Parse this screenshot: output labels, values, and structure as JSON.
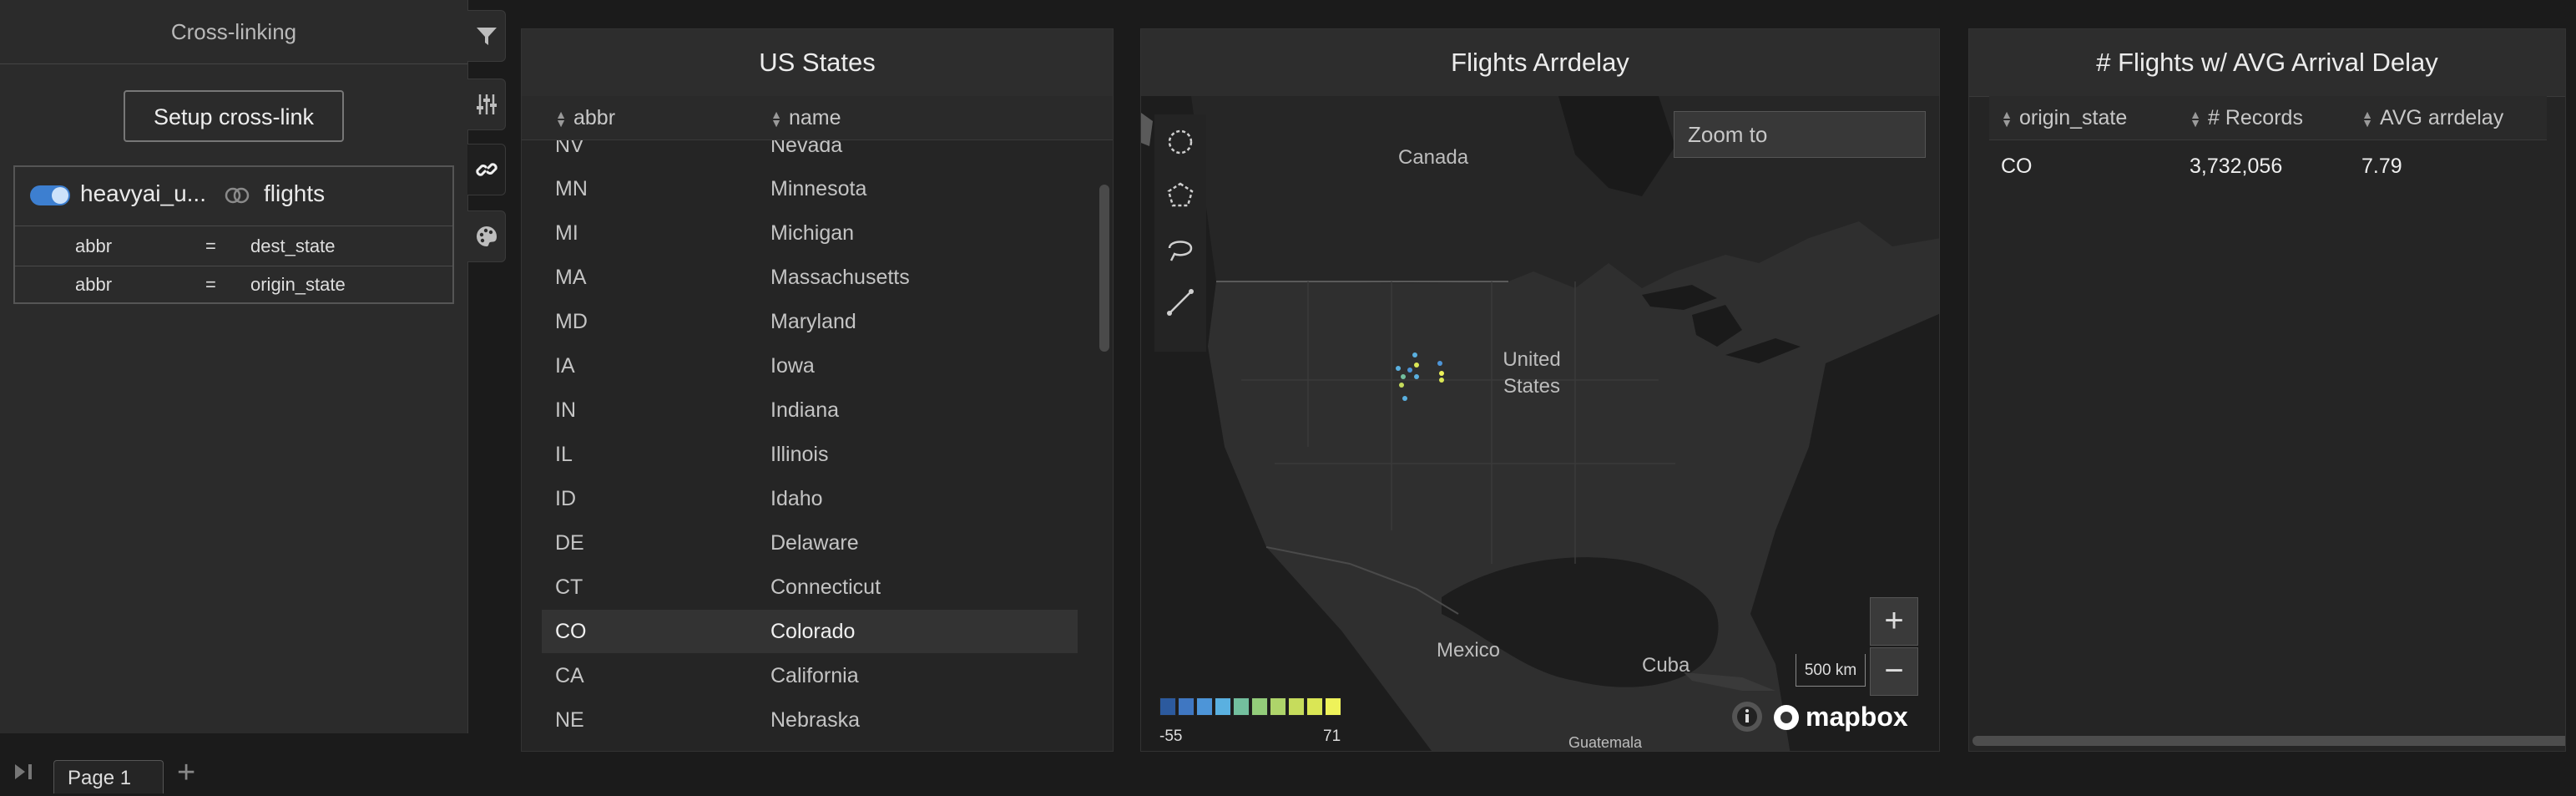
{
  "sidebar": {
    "title": "Cross-linking",
    "setup_button": "Setup cross-link",
    "link": {
      "source": "heavyai_u...",
      "target": "flights",
      "mappings": [
        {
          "left": "abbr",
          "op": "=",
          "right": "dest_state"
        },
        {
          "left": "abbr",
          "op": "=",
          "right": "origin_state"
        }
      ]
    }
  },
  "toolbar": {
    "icons": [
      "filter-icon",
      "sliders-icon",
      "link-icon",
      "palette-icon"
    ],
    "active": "link-icon"
  },
  "pages": {
    "tab_label": "Page 1",
    "add": "+"
  },
  "us_states": {
    "title": "US States",
    "columns": [
      "abbr",
      "name"
    ],
    "partial_row": {
      "abbr": "NV",
      "name": "Nevada"
    },
    "rows": [
      {
        "abbr": "MN",
        "name": "Minnesota"
      },
      {
        "abbr": "MI",
        "name": "Michigan"
      },
      {
        "abbr": "MA",
        "name": "Massachusetts"
      },
      {
        "abbr": "MD",
        "name": "Maryland"
      },
      {
        "abbr": "IA",
        "name": "Iowa"
      },
      {
        "abbr": "IN",
        "name": "Indiana"
      },
      {
        "abbr": "IL",
        "name": "Illinois"
      },
      {
        "abbr": "ID",
        "name": "Idaho"
      },
      {
        "abbr": "DE",
        "name": "Delaware"
      },
      {
        "abbr": "CT",
        "name": "Connecticut"
      },
      {
        "abbr": "CO",
        "name": "Colorado"
      },
      {
        "abbr": "CA",
        "name": "California"
      },
      {
        "abbr": "NE",
        "name": "Nebraska"
      }
    ],
    "highlighted_abbr": "CO"
  },
  "map_chart": {
    "title": "Flights Arrdelay",
    "zoom_placeholder": "Zoom to",
    "labels": {
      "canada": "Canada",
      "us": "United States",
      "mexico": "Mexico",
      "cuba": "Cuba",
      "guatemala": "Guatemala"
    },
    "scale": "500 km",
    "zoom_in": "+",
    "zoom_out": "−",
    "attribution": "mapbox",
    "legend": {
      "min": "-55",
      "max": "71",
      "colors": [
        "#2c5a9e",
        "#3f77c2",
        "#4d95d8",
        "#5ab0e0",
        "#73bf9e",
        "#93cc7a",
        "#aed46a",
        "#c6dc5c",
        "#dae655",
        "#eef25a"
      ]
    }
  },
  "flights_table": {
    "title": "# Flights w/ AVG Arrival Delay",
    "columns": [
      "origin_state",
      "# Records",
      "AVG arrdelay"
    ],
    "rows": [
      {
        "origin_state": "CO",
        "records": "3,732,056",
        "avg": "7.79"
      }
    ]
  }
}
